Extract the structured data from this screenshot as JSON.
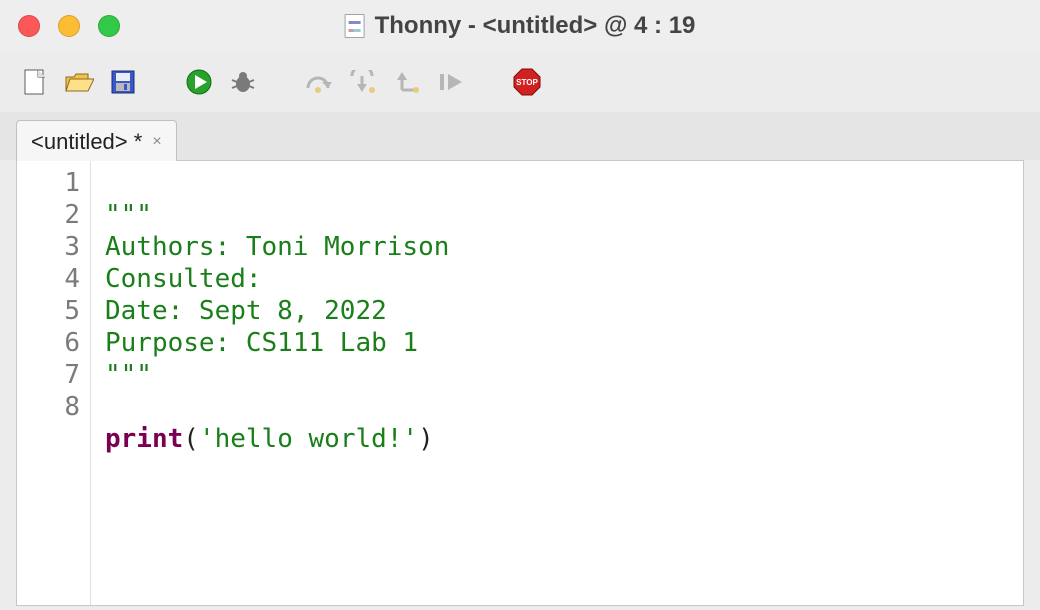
{
  "window": {
    "title_app": "Thonny",
    "title_sep": "  -  ",
    "title_file": "<untitled>",
    "title_at": "  @  ",
    "title_pos": "4 : 19"
  },
  "tab": {
    "label": "<untitled> *"
  },
  "toolbar": {
    "new": "new-file-icon",
    "open": "open-file-icon",
    "save": "save-icon",
    "run": "run-icon",
    "debug": "debug-icon",
    "step_over": "step-over-icon",
    "step_into": "step-into-icon",
    "step_out": "step-out-icon",
    "resume": "resume-icon",
    "stop": "stop-icon"
  },
  "gutter": [
    "1",
    "2",
    "3",
    "4",
    "5",
    "6",
    "7",
    "8"
  ],
  "code": {
    "l1": "\"\"\"",
    "l2": "Authors: Toni Morrison",
    "l3": "Consulted:",
    "l4a": "Date: Sept 8, 2022",
    "l5": "Purpose: CS111 Lab 1",
    "l6": "\"\"\"",
    "l7": "",
    "l8_fn": "print",
    "l8_open": "(",
    "l8_str": "'hello world!'",
    "l8_close": ")"
  }
}
